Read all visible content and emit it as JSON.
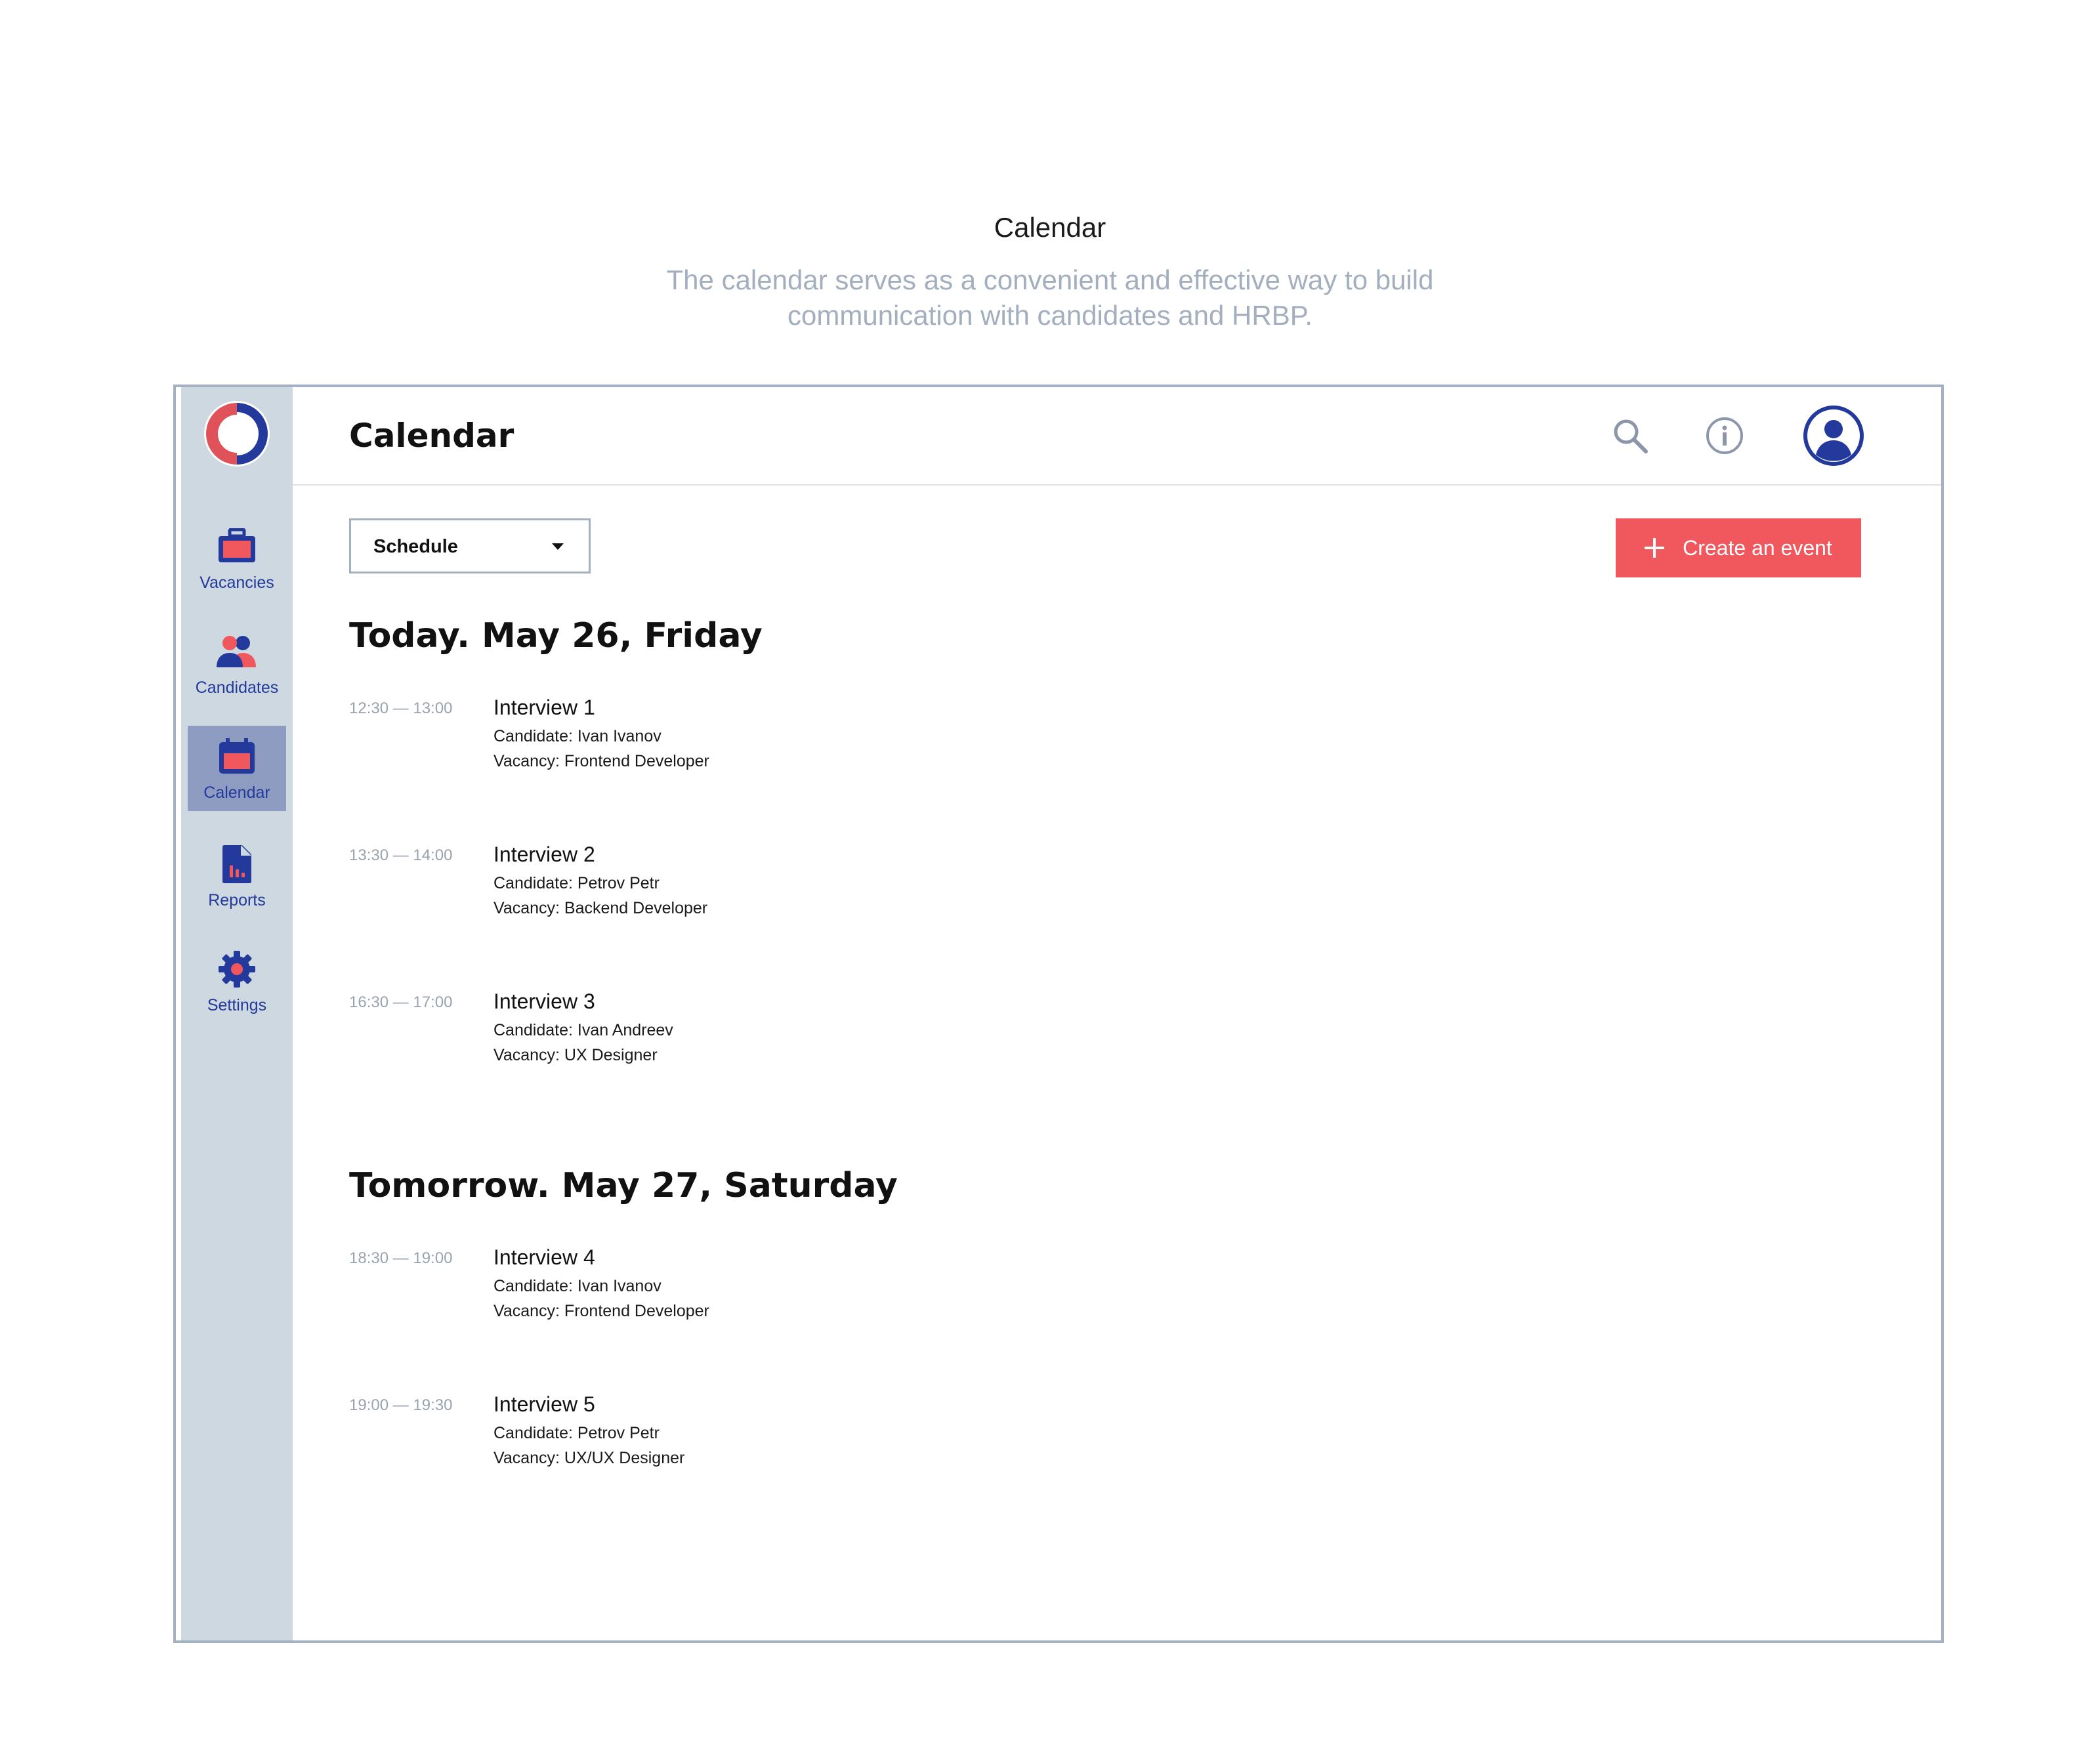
{
  "intro": {
    "title": "Calendar",
    "description": "The calendar serves as a convenient and effective way to build communication with candidates and HRBP."
  },
  "colors": {
    "brand_red": "#f0585e",
    "brand_blue": "#23399b",
    "sidebar_bg": "#ced8e0",
    "sidebar_active": "#8e9cc2",
    "frame_border": "#a4b1c3"
  },
  "sidebar": {
    "logo_icon": "brand-logo-icon",
    "items": [
      {
        "label": "Vacancies",
        "icon": "briefcase-icon",
        "active": false
      },
      {
        "label": "Candidates",
        "icon": "people-icon",
        "active": false
      },
      {
        "label": "Calendar",
        "icon": "calendar-icon",
        "active": true
      },
      {
        "label": "Reports",
        "icon": "report-icon",
        "active": false
      },
      {
        "label": "Settings",
        "icon": "gear-icon",
        "active": false
      }
    ]
  },
  "header": {
    "title": "Calendar",
    "icons": [
      "search-icon",
      "info-icon",
      "profile-icon"
    ]
  },
  "toolbar": {
    "view_select": "Schedule",
    "create_label": "Create an event"
  },
  "schedule": [
    {
      "heading": "Today. May 26, Friday",
      "events": [
        {
          "time": "12:30 — 13:00",
          "title": "Interview 1",
          "candidate": "Candidate: Ivan Ivanov",
          "vacancy": "Vacancy: Frontend Developer"
        },
        {
          "time": "13:30 — 14:00",
          "title": "Interview 2",
          "candidate": "Candidate: Petrov Petr",
          "vacancy": "Vacancy: Backend Developer"
        },
        {
          "time": "16:30 — 17:00",
          "title": "Interview 3",
          "candidate": "Candidate: Ivan Andreev",
          "vacancy": "Vacancy: UX Designer"
        }
      ]
    },
    {
      "heading": "Tomorrow. May 27, Saturday",
      "events": [
        {
          "time": "18:30 — 19:00",
          "title": "Interview 4",
          "candidate": "Candidate: Ivan Ivanov",
          "vacancy": "Vacancy: Frontend Developer"
        },
        {
          "time": "19:00 — 19:30",
          "title": "Interview 5",
          "candidate": "Candidate: Petrov Petr",
          "vacancy": "Vacancy: UX/UX Designer"
        }
      ]
    }
  ]
}
